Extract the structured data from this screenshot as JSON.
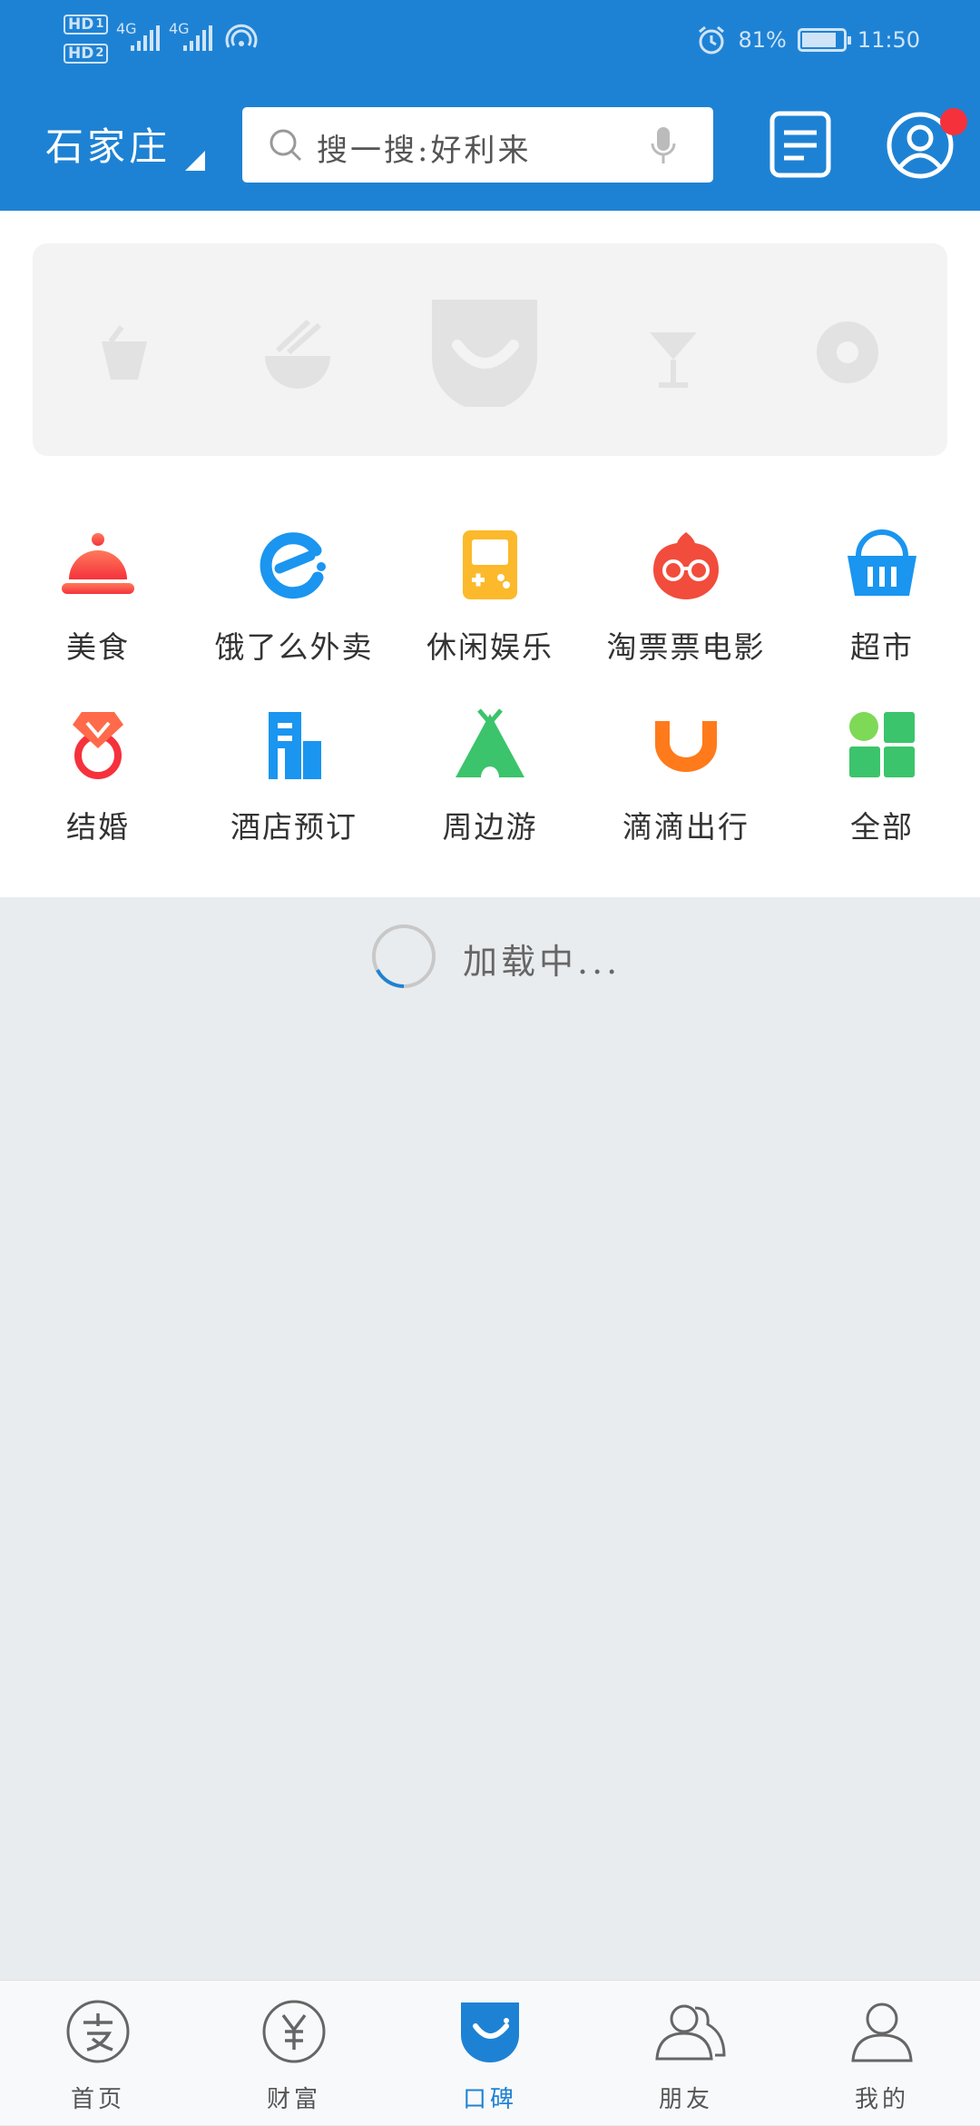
{
  "status_bar": {
    "sim1": "HD",
    "sim1_index": "1",
    "sim2": "HD",
    "sim2_index": "2",
    "network1": "4G",
    "network2": "4G",
    "battery_level": "81%",
    "battery_fraction": 0.81,
    "time": "11:50"
  },
  "header": {
    "city": "石家庄",
    "search_placeholder": "搜一搜:好利来"
  },
  "categories": [
    {
      "label": "美食",
      "icon": "food-cloche-icon"
    },
    {
      "label": "饿了么外卖",
      "icon": "eleme-icon"
    },
    {
      "label": "休闲娱乐",
      "icon": "gameboy-icon"
    },
    {
      "label": "淘票票电影",
      "icon": "taopiaopiao-icon"
    },
    {
      "label": "超市",
      "icon": "basket-icon"
    },
    {
      "label": "结婚",
      "icon": "ring-icon"
    },
    {
      "label": "酒店预订",
      "icon": "hotel-icon"
    },
    {
      "label": "周边游",
      "icon": "tent-icon"
    },
    {
      "label": "滴滴出行",
      "icon": "didi-icon"
    },
    {
      "label": "全部",
      "icon": "grid-icon"
    }
  ],
  "loading_text": "加载中...",
  "tabs": [
    {
      "label": "首页",
      "icon": "alipay-home-icon",
      "active": false
    },
    {
      "label": "财富",
      "icon": "yuan-icon",
      "active": false
    },
    {
      "label": "口碑",
      "icon": "koubei-icon",
      "active": true
    },
    {
      "label": "朋友",
      "icon": "friends-icon",
      "active": false
    },
    {
      "label": "我的",
      "icon": "person-icon",
      "active": false
    }
  ],
  "colors": {
    "brand_blue": "#1e82d4",
    "notification_red": "#f5323c",
    "loading_background": "#e9ecee"
  }
}
